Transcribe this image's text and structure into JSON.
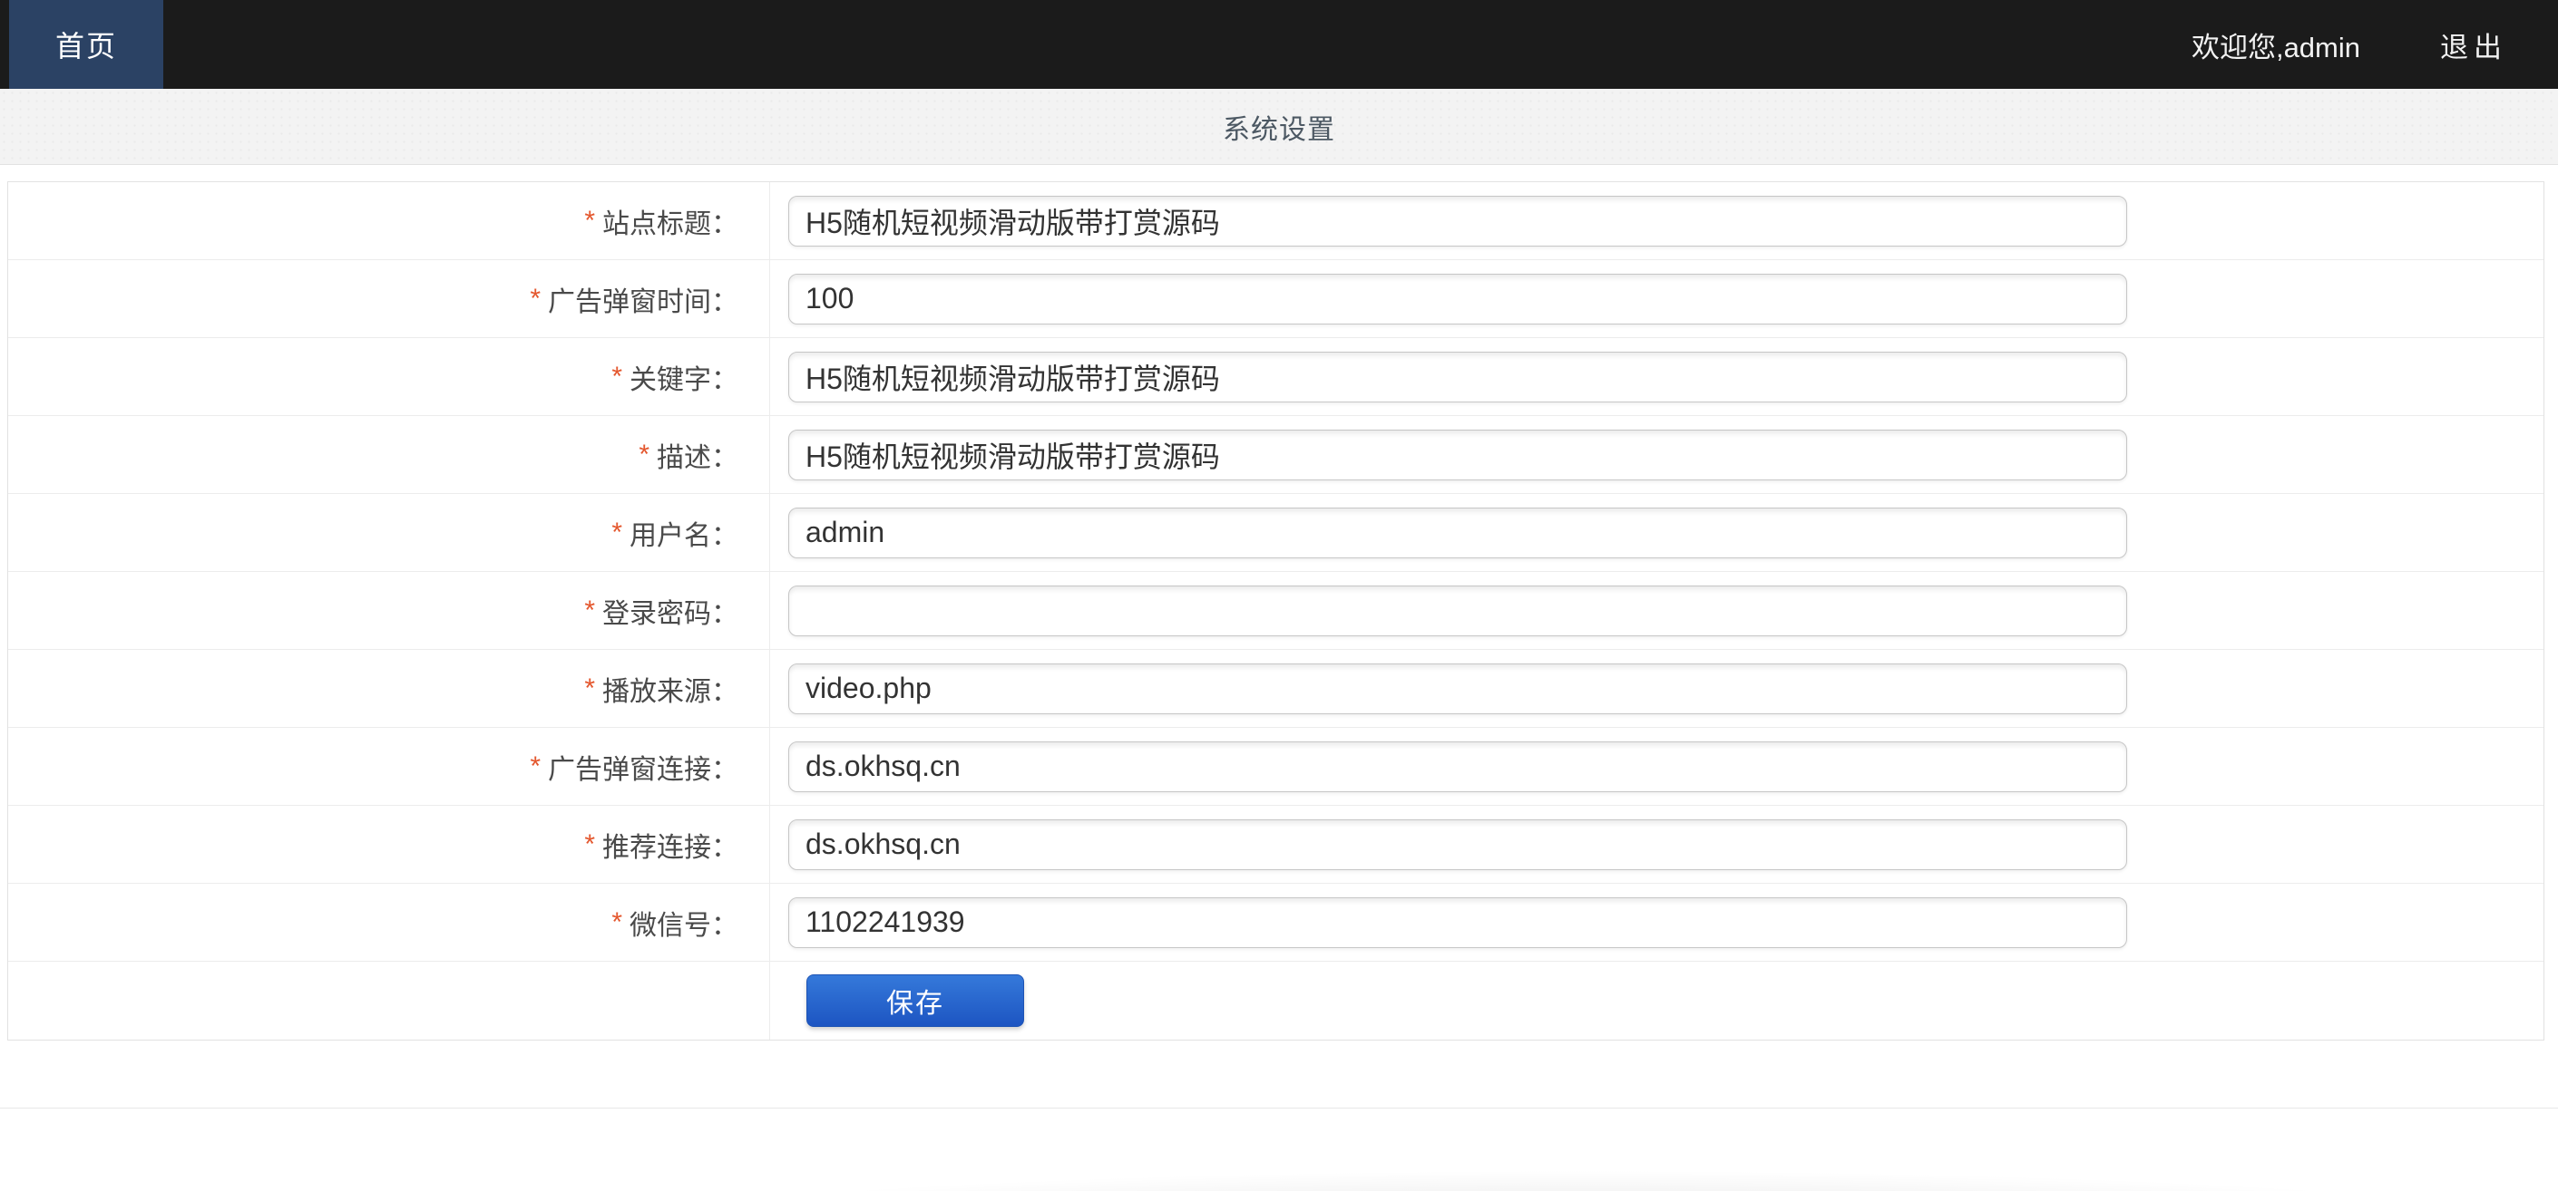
{
  "topbar": {
    "home_tab": "首页",
    "welcome": "欢迎您,admin",
    "logout": "退出"
  },
  "page": {
    "title": "系统设置"
  },
  "form": {
    "required_marker": "*",
    "save_label": "保存",
    "fields": [
      {
        "name": "site-title",
        "label": "站点标题：",
        "value": "H5随机短视频滑动版带打赏源码",
        "type": "text"
      },
      {
        "name": "ad-popup-time",
        "label": "广告弹窗时间：",
        "value": "100",
        "type": "text"
      },
      {
        "name": "keywords",
        "label": "关键字：",
        "value": "H5随机短视频滑动版带打赏源码",
        "type": "text"
      },
      {
        "name": "description",
        "label": "描述：",
        "value": "H5随机短视频滑动版带打赏源码",
        "type": "text"
      },
      {
        "name": "username",
        "label": "用户名：",
        "value": "admin",
        "type": "text"
      },
      {
        "name": "login-password",
        "label": "登录密码：",
        "value": "",
        "type": "text"
      },
      {
        "name": "play-source",
        "label": "播放来源：",
        "value": "video.php",
        "type": "text"
      },
      {
        "name": "ad-popup-link",
        "label": "广告弹窗连接：",
        "value": "ds.okhsq.cn",
        "type": "text"
      },
      {
        "name": "recommend-link",
        "label": "推荐连接：",
        "value": "ds.okhsq.cn",
        "type": "text"
      },
      {
        "name": "wechat-id",
        "label": "微信号：",
        "value": "1102241939",
        "type": "text"
      }
    ]
  },
  "colors": {
    "topbar_bg": "#1b1b1b",
    "tab_blue": "#2b4264",
    "asterisk_red": "#e4572e",
    "button_blue_top": "#3579da",
    "button_blue_bottom": "#1d55c2",
    "band_gray": "#f3f3f3"
  }
}
